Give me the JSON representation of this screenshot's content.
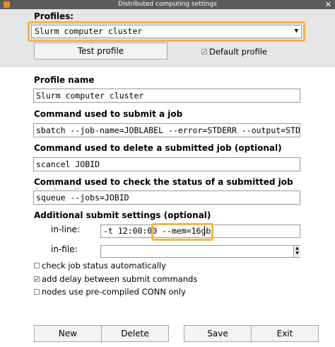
{
  "window": {
    "title": "Distributed computing settings"
  },
  "profiles": {
    "label": "Profiles:",
    "selected": "Slurm computer cluster",
    "test_button": "Test profile",
    "default_label": "Default profile",
    "default_checked": true
  },
  "profile_name": {
    "label": "Profile name",
    "value": "Slurm computer cluster"
  },
  "submit_cmd": {
    "label": "Command used to submit a job",
    "value": "sbatch --job-name=JOBLABEL --error=STDERR --output=STDOUT O"
  },
  "delete_cmd": {
    "label": "Command used to delete a submitted job (optional)",
    "value": "scancel JOBID"
  },
  "status_cmd": {
    "label": "Command used to check the status of a submitted job (optional)",
    "value": "squeue --jobs=JOBID"
  },
  "additional": {
    "label": "Additional submit settings (optional)",
    "inline_label": "in-line:",
    "inline_value_part1": "-t 12:00:00 ",
    "inline_value_part2": "--mem=16gb",
    "infile_label": "in-file:",
    "infile_value": ""
  },
  "options": [
    {
      "label": "check job status automatically",
      "checked": false
    },
    {
      "label": "add delay between submit commands",
      "checked": true
    },
    {
      "label": "nodes use pre-compiled CONN only",
      "checked": false
    }
  ],
  "buttons": {
    "new": "New",
    "delete": "Delete",
    "save": "Save",
    "exit": "Exit"
  },
  "colors": {
    "highlight": "#f2b63d",
    "titlebar": "#5b5b5b",
    "top_panel": "#e6e6e6"
  }
}
